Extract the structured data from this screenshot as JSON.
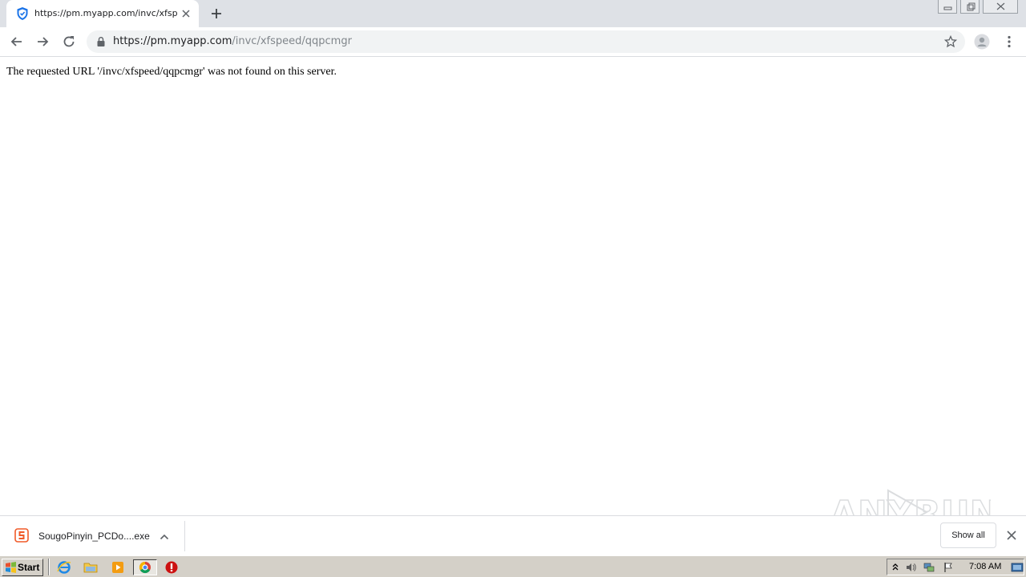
{
  "browser": {
    "tab": {
      "title": "https://pm.myapp.com/invc/xfspeed/qqpcmgr",
      "favicon": "shield-icon"
    },
    "address_bar": {
      "url_host": "https://pm.myapp.com",
      "url_path": "/invc/xfspeed/qqpcmgr"
    }
  },
  "page": {
    "error_message": "The requested URL '/invc/xfspeed/qqpcmgr' was not found on this server."
  },
  "watermark": {
    "text_left": "ANY",
    "text_right": "RUN"
  },
  "download_shelf": {
    "item": {
      "filename": "SougoPinyin_PCDo....exe",
      "icon": "sogou-s-icon"
    },
    "show_all_label": "Show all"
  },
  "taskbar": {
    "start_label": "Start",
    "clock": "7:08 AM",
    "apps": [
      "ie-icon",
      "explorer-folder-icon",
      "media-player-icon",
      "chrome-icon",
      "stop-icon"
    ]
  },
  "colors": {
    "tab_strip": "#dee1e6",
    "omnibox": "#f1f3f4",
    "favicon_blue": "#1a73e8",
    "sogou_orange": "#f05a28",
    "taskbar": "#d4d0c8"
  }
}
